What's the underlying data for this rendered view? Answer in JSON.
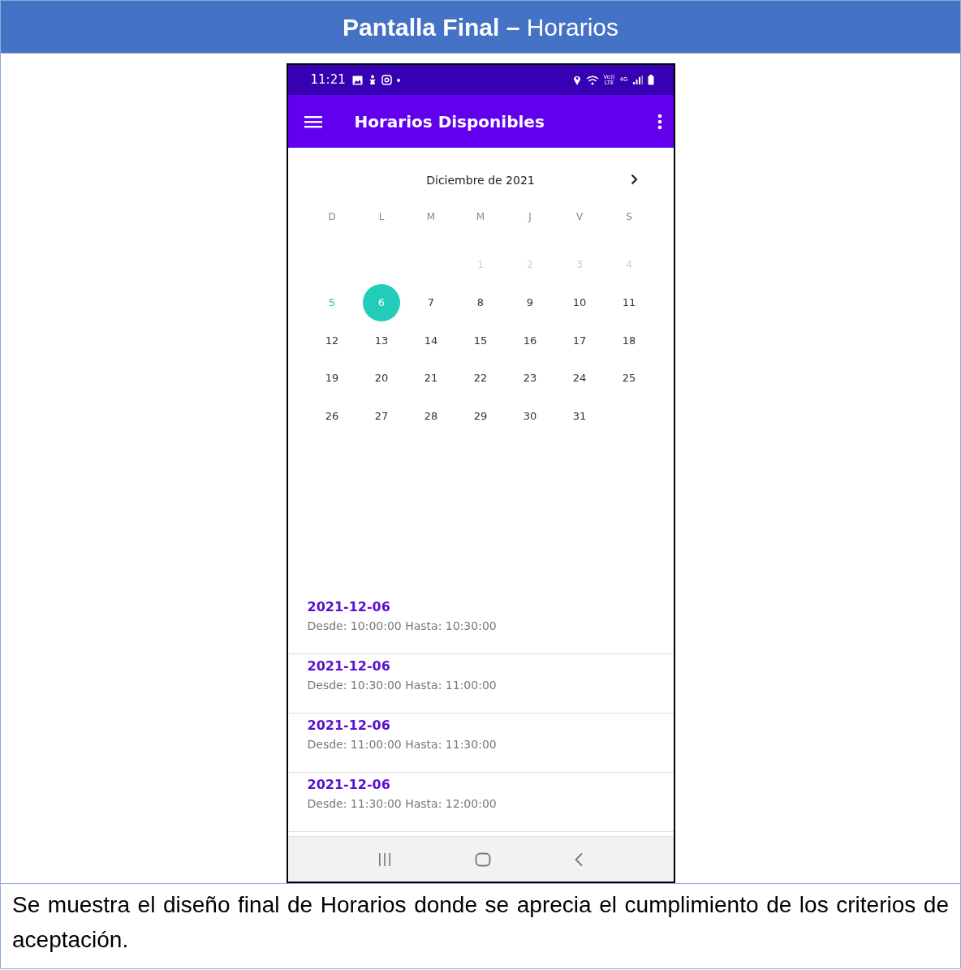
{
  "document": {
    "title": "**Pantalla Final –** Horarios",
    "caption": "Se muestra el diseño final de Horarios donde se aprecia el cumplimiento de los criterios de aceptación."
  },
  "status_bar": {
    "time": "11:21",
    "volte": [
      "Vo))",
      "LTE"
    ],
    "network": "4G"
  },
  "app_bar": {
    "title": "Horarios Disponibles"
  },
  "calendar": {
    "month": "Diciembre de 2021",
    "weekdays": [
      "D",
      "L",
      "M",
      "M",
      "J",
      "V",
      "S"
    ],
    "weeks": [
      [
        {
          "kind": "blank"
        },
        {
          "kind": "blank"
        },
        {
          "kind": "blank"
        },
        {
          "label": "1",
          "kind": "past",
          "selected": false
        },
        {
          "label": "2",
          "kind": "past",
          "selected": false
        },
        {
          "label": "3",
          "kind": "past",
          "selected": false
        },
        {
          "label": "4",
          "kind": "past",
          "selected": false
        }
      ],
      [
        {
          "label": "5",
          "kind": "today",
          "selected": false
        },
        {
          "label": "6",
          "kind": "plain",
          "selected": true
        },
        {
          "label": "7",
          "kind": "plain",
          "selected": false
        },
        {
          "label": "8",
          "kind": "plain",
          "selected": false
        },
        {
          "label": "9",
          "kind": "plain",
          "selected": false
        },
        {
          "label": "10",
          "kind": "plain",
          "selected": false
        },
        {
          "label": "11",
          "kind": "plain",
          "selected": false
        }
      ],
      [
        {
          "label": "12",
          "kind": "plain",
          "selected": false
        },
        {
          "label": "13",
          "kind": "plain",
          "selected": false
        },
        {
          "label": "14",
          "kind": "plain",
          "selected": false
        },
        {
          "label": "15",
          "kind": "plain",
          "selected": false
        },
        {
          "label": "16",
          "kind": "plain",
          "selected": false
        },
        {
          "label": "17",
          "kind": "plain",
          "selected": false
        },
        {
          "label": "18",
          "kind": "plain",
          "selected": false
        }
      ],
      [
        {
          "label": "19",
          "kind": "plain",
          "selected": false
        },
        {
          "label": "20",
          "kind": "plain",
          "selected": false
        },
        {
          "label": "21",
          "kind": "plain",
          "selected": false
        },
        {
          "label": "22",
          "kind": "plain",
          "selected": false
        },
        {
          "label": "23",
          "kind": "plain",
          "selected": false
        },
        {
          "label": "24",
          "kind": "plain",
          "selected": false
        },
        {
          "label": "25",
          "kind": "plain",
          "selected": false
        }
      ],
      [
        {
          "label": "26",
          "kind": "plain",
          "selected": false
        },
        {
          "label": "27",
          "kind": "plain",
          "selected": false
        },
        {
          "label": "28",
          "kind": "plain",
          "selected": false
        },
        {
          "label": "29",
          "kind": "plain",
          "selected": false
        },
        {
          "label": "30",
          "kind": "plain",
          "selected": false
        },
        {
          "label": "31",
          "kind": "plain",
          "selected": false
        },
        {
          "kind": "blank"
        }
      ]
    ]
  },
  "slots": [
    {
      "date": "2021-12-06",
      "range": "Desde: 10:00:00 Hasta: 10:30:00"
    },
    {
      "date": "2021-12-06",
      "range": "Desde: 10:30:00 Hasta: 11:00:00"
    },
    {
      "date": "2021-12-06",
      "range": "Desde: 11:00:00 Hasta: 11:30:00"
    },
    {
      "date": "2021-12-06",
      "range": "Desde: 11:30:00 Hasta: 12:00:00"
    }
  ]
}
